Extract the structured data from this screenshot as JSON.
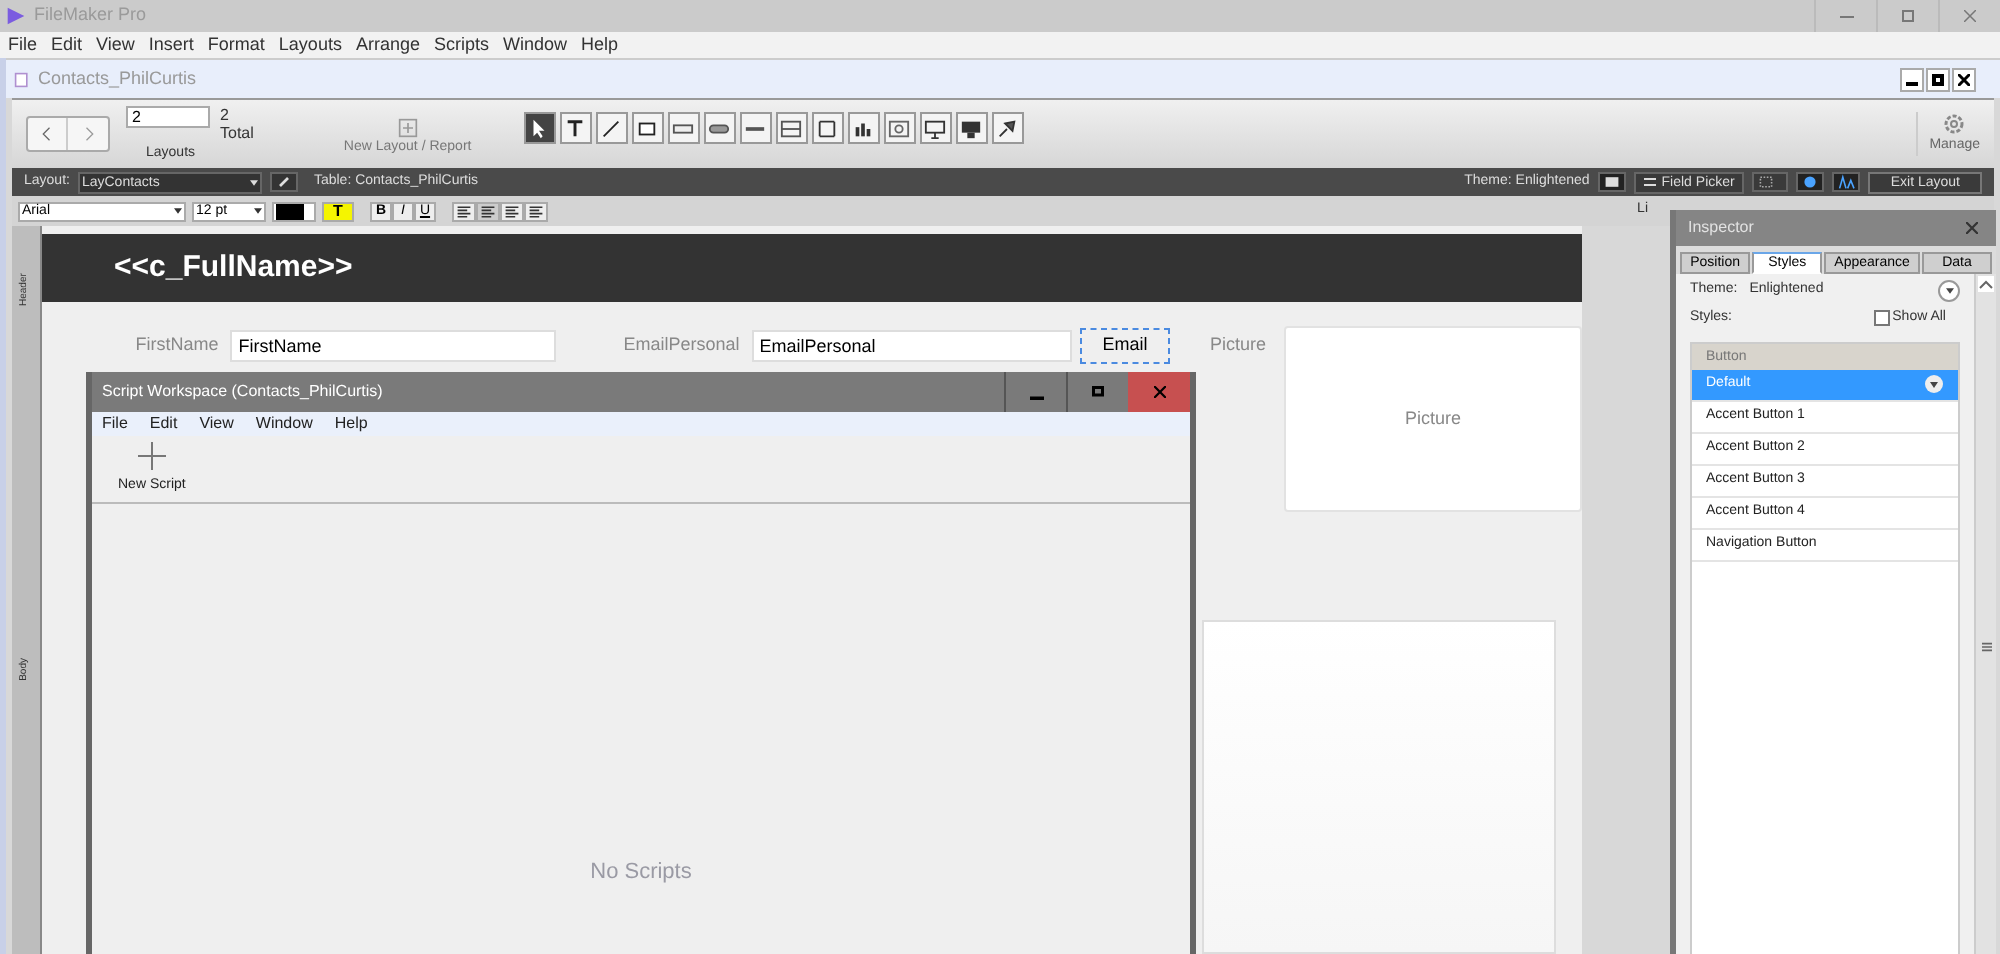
{
  "app": {
    "title": "FileMaker Pro"
  },
  "menu": [
    "File",
    "Edit",
    "View",
    "Insert",
    "Format",
    "Layouts",
    "Arrange",
    "Scripts",
    "Window",
    "Help"
  ],
  "document": {
    "title": "Contacts_PhilCurtis"
  },
  "toolbar": {
    "record_field": "2",
    "total_count": "2",
    "total_label": "Total",
    "layouts_label": "Layouts",
    "new_layout": "New Layout / Report",
    "manage": "Manage"
  },
  "layout_bar": {
    "layout_label": "Layout:",
    "layout_value": "LayContacts",
    "table": "Table: Contacts_PhilCurtis",
    "theme": "Theme: Enlightened",
    "field_picker": "Field Picker",
    "exit": "Exit Layout"
  },
  "format_bar": {
    "font": "Arial",
    "size": "12 pt",
    "highlight": "T",
    "bold": "B",
    "italic": "I",
    "underline": "U",
    "ruler_label": "Li"
  },
  "layout": {
    "parts": [
      {
        "label": "Header"
      },
      {
        "label": "Body"
      }
    ],
    "heading": "<<c_FullName>>",
    "fields": [
      {
        "label": "FirstName",
        "value": "FirstName"
      },
      {
        "label": "EmailPersonal",
        "value": "EmailPersonal"
      }
    ],
    "email_button": {
      "label": "Email",
      "selected": true
    },
    "picture_label": "Picture",
    "picture_box": "Picture"
  },
  "script_workspace": {
    "title": "Script Workspace (Contacts_PhilCurtis)",
    "menu": [
      "File",
      "Edit",
      "View",
      "Window",
      "Help"
    ],
    "new_script": "New Script",
    "empty": "No Scripts"
  },
  "inspector": {
    "title": "Inspector",
    "tabs": [
      {
        "label": "Position",
        "selected": false
      },
      {
        "label": "Styles",
        "selected": true
      },
      {
        "label": "Appearance",
        "selected": false
      },
      {
        "label": "Data",
        "selected": false
      }
    ],
    "theme_label": "Theme:",
    "theme_value": "Enlightened",
    "styles_label": "Styles:",
    "show_all": {
      "label": "Show All",
      "checked": false
    },
    "group": "Button",
    "styles": [
      {
        "label": "Default",
        "selected": true
      },
      {
        "label": "Accent Button 1",
        "selected": false
      },
      {
        "label": "Accent Button 2",
        "selected": false
      },
      {
        "label": "Accent Button 3",
        "selected": false
      },
      {
        "label": "Accent Button 4",
        "selected": false
      },
      {
        "label": "Navigation Button",
        "selected": false
      }
    ]
  }
}
